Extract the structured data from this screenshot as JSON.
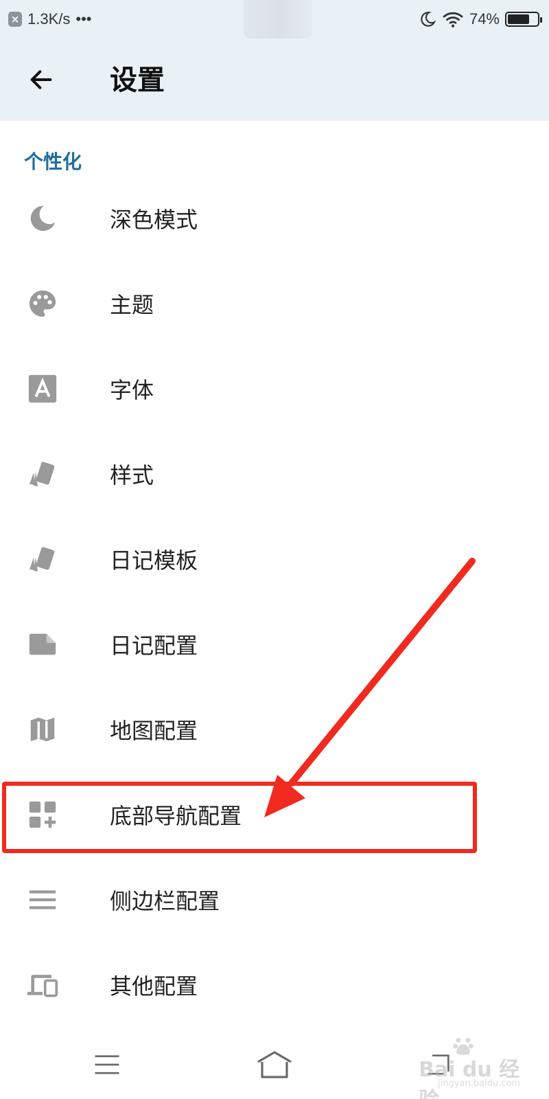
{
  "status_bar": {
    "speed": "1.3K/s",
    "more": "•••",
    "battery": "74%",
    "battery_level": 0.74
  },
  "app_bar": {
    "title": "设置"
  },
  "section": {
    "title": "个性化"
  },
  "items": [
    {
      "label": "深色模式",
      "icon": "moon-icon"
    },
    {
      "label": "主题",
      "icon": "palette-icon"
    },
    {
      "label": "字体",
      "icon": "font-icon"
    },
    {
      "label": "样式",
      "icon": "style-icon"
    },
    {
      "label": "日记模板",
      "icon": "style-icon"
    },
    {
      "label": "日记配置",
      "icon": "note-icon"
    },
    {
      "label": "地图配置",
      "icon": "map-icon"
    },
    {
      "label": "底部导航配置",
      "icon": "dashboard-add-icon"
    },
    {
      "label": "侧边栏配置",
      "icon": "menu-icon"
    },
    {
      "label": "其他配置",
      "icon": "devices-icon"
    }
  ],
  "watermark": {
    "brand": "Bai du 经验",
    "url": "jingyan.baidu.com"
  },
  "colors": {
    "header_bg": "#e9f0f6",
    "accent": "#1f6e9e",
    "icon": "#9a9a9a",
    "highlight": "#f02a1f"
  }
}
